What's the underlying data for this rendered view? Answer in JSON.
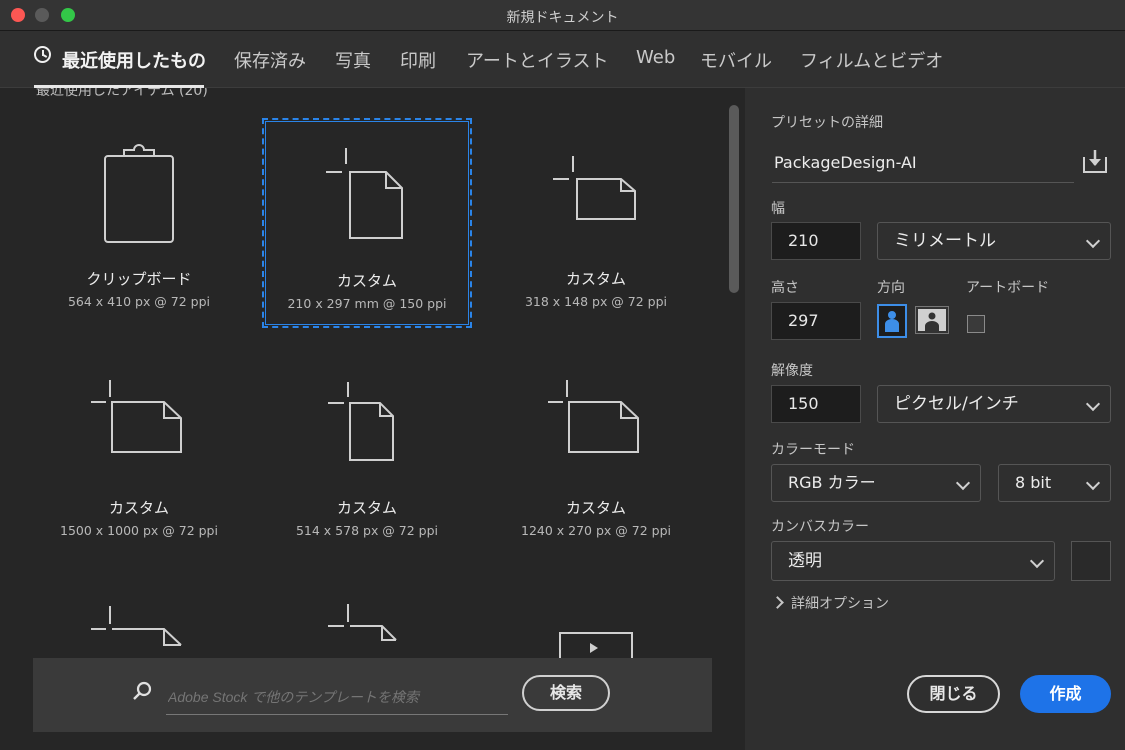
{
  "window": {
    "title": "新規ドキュメント"
  },
  "tabs": [
    {
      "label": "最近使用したもの",
      "active": true
    },
    {
      "label": "保存済み"
    },
    {
      "label": "写真"
    },
    {
      "label": "印刷"
    },
    {
      "label": "アートとイラスト"
    },
    {
      "label": "Web"
    },
    {
      "label": "モバイル"
    },
    {
      "label": "フィルムとビデオ"
    }
  ],
  "recent": {
    "section_title": "最近使用したアイテム (20)",
    "items": [
      {
        "name": "クリップボード",
        "meta": "564 x 410 px @ 72 ppi",
        "icon": "clipboard-icon"
      },
      {
        "name": "カスタム",
        "meta": "210 x 297 mm @ 150 ppi",
        "icon": "portrait-document-icon",
        "selected": true
      },
      {
        "name": "カスタム",
        "meta": "318 x 148 px @ 72 ppi",
        "icon": "landscape-document-icon"
      },
      {
        "name": "カスタム",
        "meta": "1500 x 1000 px @ 72 ppi",
        "icon": "landscape-document-icon"
      },
      {
        "name": "カスタム",
        "meta": "514 x 578 px @ 72 ppi",
        "icon": "portrait-document-icon"
      },
      {
        "name": "カスタム",
        "meta": "1240 x 270 px @ 72 ppi",
        "icon": "landscape-document-icon"
      }
    ]
  },
  "search": {
    "placeholder": "Adobe Stock で他のテンプレートを検索",
    "button_label": "検索"
  },
  "preset": {
    "section_label": "プリセットの詳細",
    "name": "PackageDesign-AI",
    "width_label": "幅",
    "width_value": "210",
    "unit_value": "ミリメートル",
    "height_label": "高さ",
    "height_value": "297",
    "orientation_label": "方向",
    "artboard_label": "アートボード",
    "resolution_label": "解像度",
    "resolution_value": "150",
    "resolution_unit": "ピクセル/インチ",
    "color_mode_label": "カラーモード",
    "color_mode_value": "RGB カラー",
    "bit_depth_value": "8 bit",
    "canvas_color_label": "カンバスカラー",
    "canvas_color_value": "透明",
    "advanced_label": "詳細オプション"
  },
  "actions": {
    "close_label": "閉じる",
    "create_label": "作成"
  },
  "colors": {
    "accent": "#1e73e8",
    "selection": "#2a84e8"
  }
}
